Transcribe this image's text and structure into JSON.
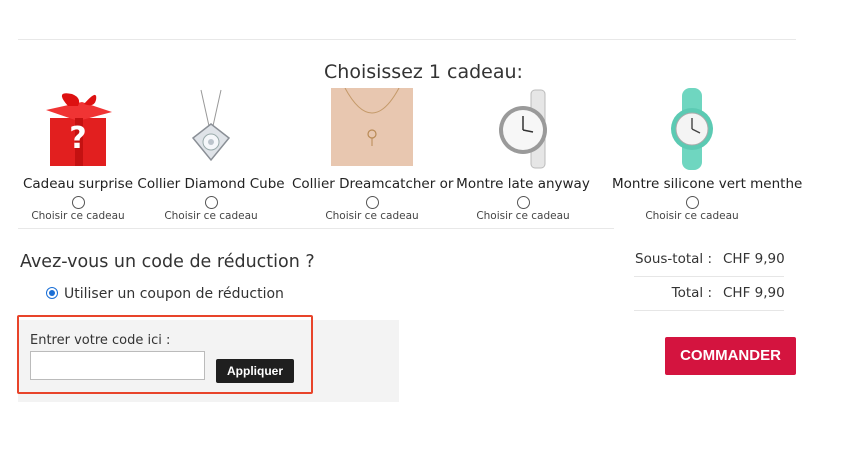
{
  "gifts": {
    "title": "Choisissez 1 cadeau:",
    "choose_label": "Choisir ce cadeau",
    "items": [
      {
        "name": "Cadeau surprise",
        "icon": "surprise-gift-box-icon"
      },
      {
        "name": "Collier Diamond Cube",
        "icon": "diamond-cube-necklace-icon"
      },
      {
        "name": "Collier Dreamcatcher or",
        "icon": "dreamcatcher-necklace-icon"
      },
      {
        "name": "Montre late anyway",
        "icon": "white-watch-icon"
      },
      {
        "name": "Montre silicone vert menthe",
        "icon": "mint-watch-icon"
      }
    ]
  },
  "coupon": {
    "title": "Avez-vous un code de réduction ?",
    "option_label": "Utiliser un coupon de réduction",
    "input_label": "Entrer votre code ici :",
    "input_value": "",
    "apply_label": "Appliquer"
  },
  "totals": {
    "subtotal_label": "Sous-total :",
    "subtotal_value": "CHF 9,90",
    "total_label": "Total :",
    "total_value": "CHF 9,90"
  },
  "order": {
    "label": "COMMANDER"
  },
  "colors": {
    "accent": "#d4143f",
    "highlight": "#e8442a",
    "radio": "#1a6fd6"
  }
}
